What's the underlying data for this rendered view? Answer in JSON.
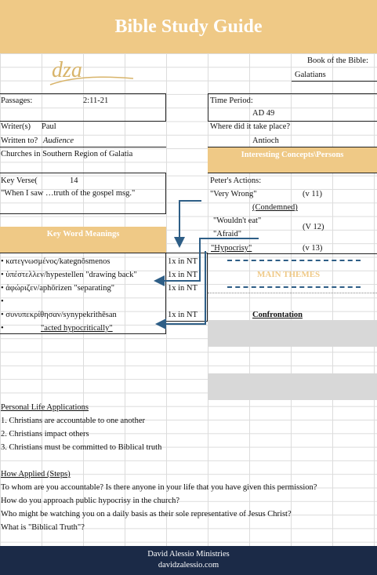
{
  "header": {
    "title": "Bible Study Guide"
  },
  "logo": {
    "text": "dza"
  },
  "book": {
    "label": "Book of the Bible:",
    "value": "Galatians"
  },
  "passages": {
    "label": "Passages:",
    "value": "2:11-21"
  },
  "time_period": {
    "label": "Time Period:",
    "value": "AD 49"
  },
  "writer": {
    "label": "Writer(s)",
    "value": "Paul"
  },
  "written_to": {
    "label": "Written to?",
    "value": "Audience",
    "detail": "Churches in Southern Region of Galatia"
  },
  "where": {
    "label": "Where did it take place?",
    "value": "Antioch"
  },
  "concepts_header": "Interesting Concepts\\Persons",
  "key_verse": {
    "label": "Key Verse(",
    "number": "14",
    "text": "\"When I saw …truth of the gospel msg.\""
  },
  "peters_actions": {
    "label": "Peter's Actions:",
    "items": [
      {
        "text": "\"Very Wrong\"",
        "ref": "(v 11)"
      },
      {
        "text": "(Condemned)"
      },
      {
        "text": "\"Wouldn't eat\"",
        "ref": "(V 12)"
      },
      {
        "text": "\"Afraid\""
      },
      {
        "text": "\"Hypocrisy\"",
        "ref": "(v 13)"
      }
    ]
  },
  "key_words": {
    "header": "Key Word Meanings",
    "items": [
      {
        "word": "• κατεγνωσμένος/kategnōsmenos",
        "count": "1x in NT"
      },
      {
        "word": "• ὑπέστελλεν/hypestellen \"drawing back\"",
        "count": "1x in NT"
      },
      {
        "word": "• ἀφώριζεν/aphōrizen \"separating\"",
        "count": "1x in NT"
      },
      {
        "word": "•",
        "count": ""
      },
      {
        "word": "• συνυπεκρίθησαν/synypekrithēsan",
        "count": "1x in NT"
      },
      {
        "word": "•",
        "note": "\"acted hypocritically\"",
        "count": ""
      }
    ]
  },
  "main_themes": {
    "title": "MAIN THEMES",
    "items": [
      "Confrontation"
    ]
  },
  "applications": {
    "title": "Personal Life Applications",
    "items": [
      "1. Christians are accountable to one another",
      "2. Christians impact others",
      "3. Christians must be committed to Biblical truth"
    ]
  },
  "how_applied": {
    "title": "How Applied (Steps)",
    "items": [
      "To whom are you accountable? Is there anyone in your life that you have given this permission?",
      "How do you approach public hypocrisy in the church?",
      "Who might be watching you on a daily basis as their sole representative of Jesus Christ?",
      "What is \"Biblical Truth\"?"
    ]
  },
  "footer": {
    "org": "David Alessio Ministries",
    "site": "davidzalessio.com"
  },
  "colors": {
    "gold": "#efc986",
    "navy": "#1b2a47",
    "arrow": "#2e5e86"
  }
}
